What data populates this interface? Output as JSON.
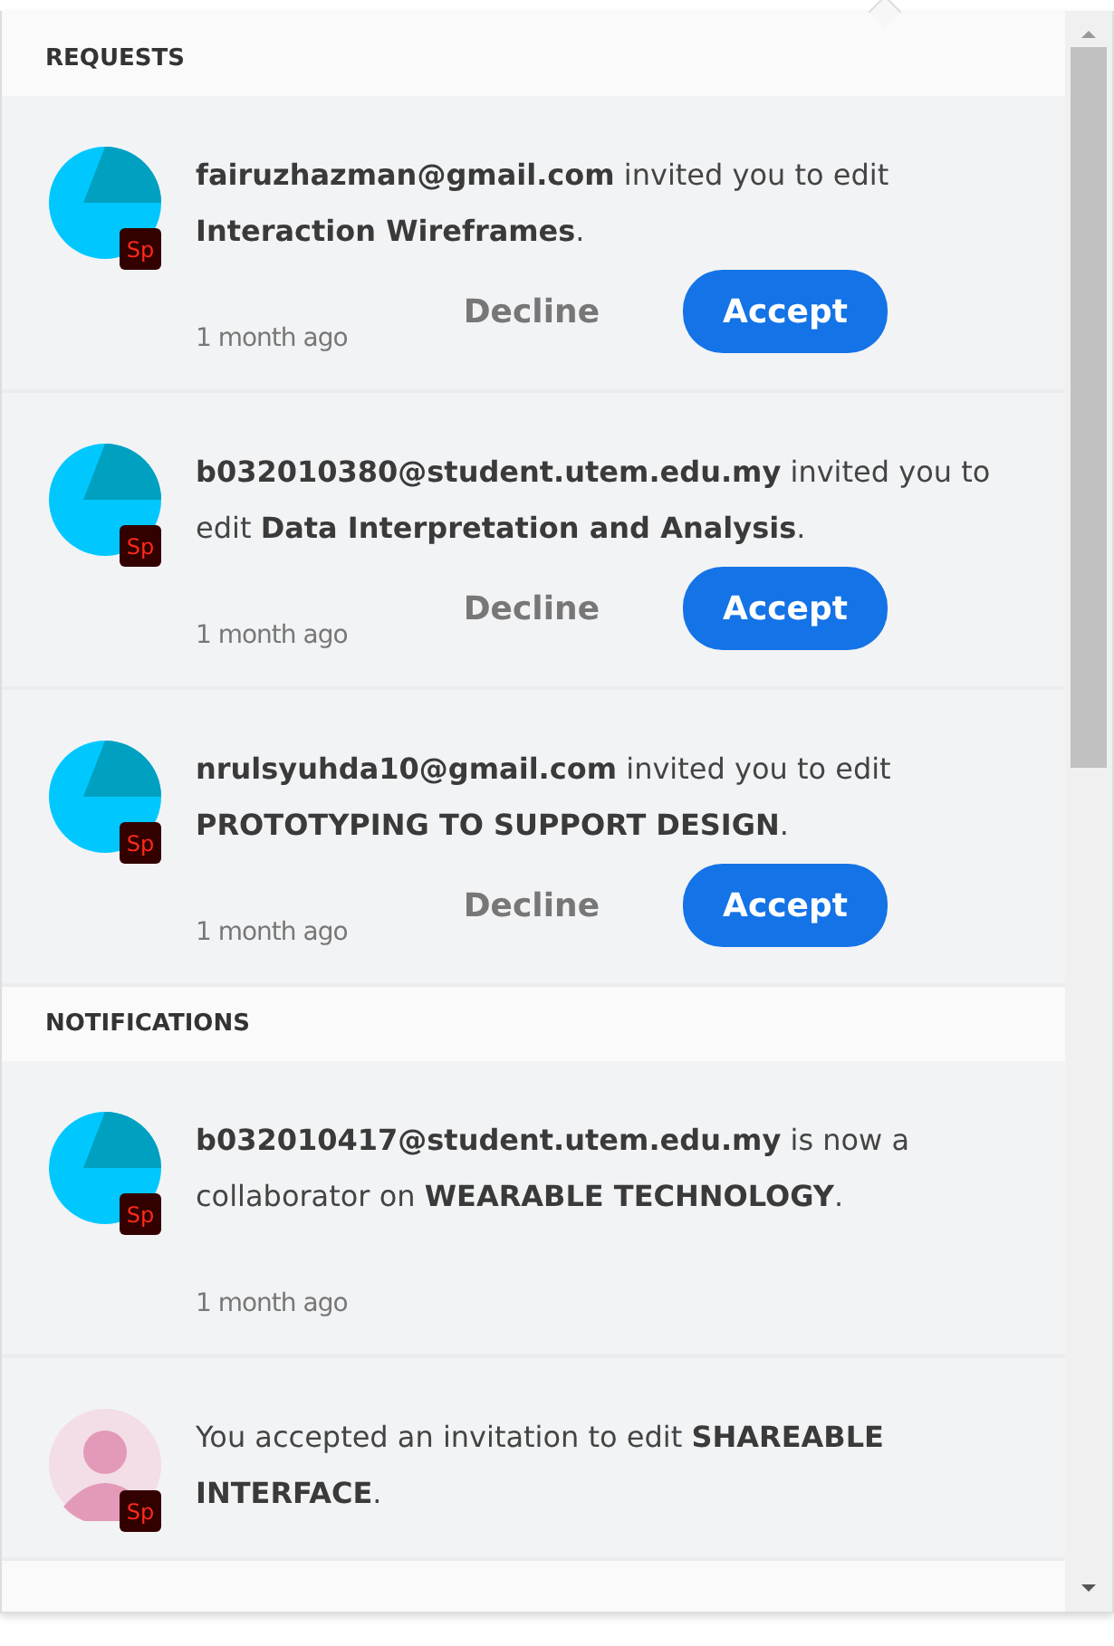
{
  "sections": [
    {
      "title": "REQUESTS",
      "items": [
        {
          "avatar": {
            "kind": "app",
            "badge": "Sp"
          },
          "message": "**fairuzhazman@gmail.com** invited you to edit **Interaction Wireframes**.",
          "time": "1 month ago",
          "actions": [
            {
              "kind": "secondary",
              "label": "Decline"
            },
            {
              "kind": "primary",
              "label": "Accept"
            }
          ]
        },
        {
          "avatar": {
            "kind": "app",
            "badge": "Sp"
          },
          "message": "**b032010380@student.utem.edu.my** invited you to edit **Data Interpretation and Analysis**.",
          "time": "1 month ago",
          "actions": [
            {
              "kind": "secondary",
              "label": "Decline"
            },
            {
              "kind": "primary",
              "label": "Accept"
            }
          ]
        },
        {
          "avatar": {
            "kind": "app",
            "badge": "Sp"
          },
          "message": "**nrulsyuhda10@gmail.com** invited you to edit **PROTOTYPING TO SUPPORT DESIGN**.",
          "time": "1 month ago",
          "actions": [
            {
              "kind": "secondary",
              "label": "Decline"
            },
            {
              "kind": "primary",
              "label": "Accept"
            }
          ]
        }
      ]
    },
    {
      "title": "NOTIFICATIONS",
      "items": [
        {
          "avatar": {
            "kind": "app",
            "badge": "Sp"
          },
          "message": "**b032010417@student.utem.edu.my** is now a collaborator on **WEARABLE TECHNOLOGY**.",
          "time": "1 month ago"
        },
        {
          "avatar": {
            "kind": "photo",
            "badge": "Sp"
          },
          "message": "You accepted an invitation to edit **SHAREABLE INTERFACE**."
        }
      ]
    }
  ]
}
